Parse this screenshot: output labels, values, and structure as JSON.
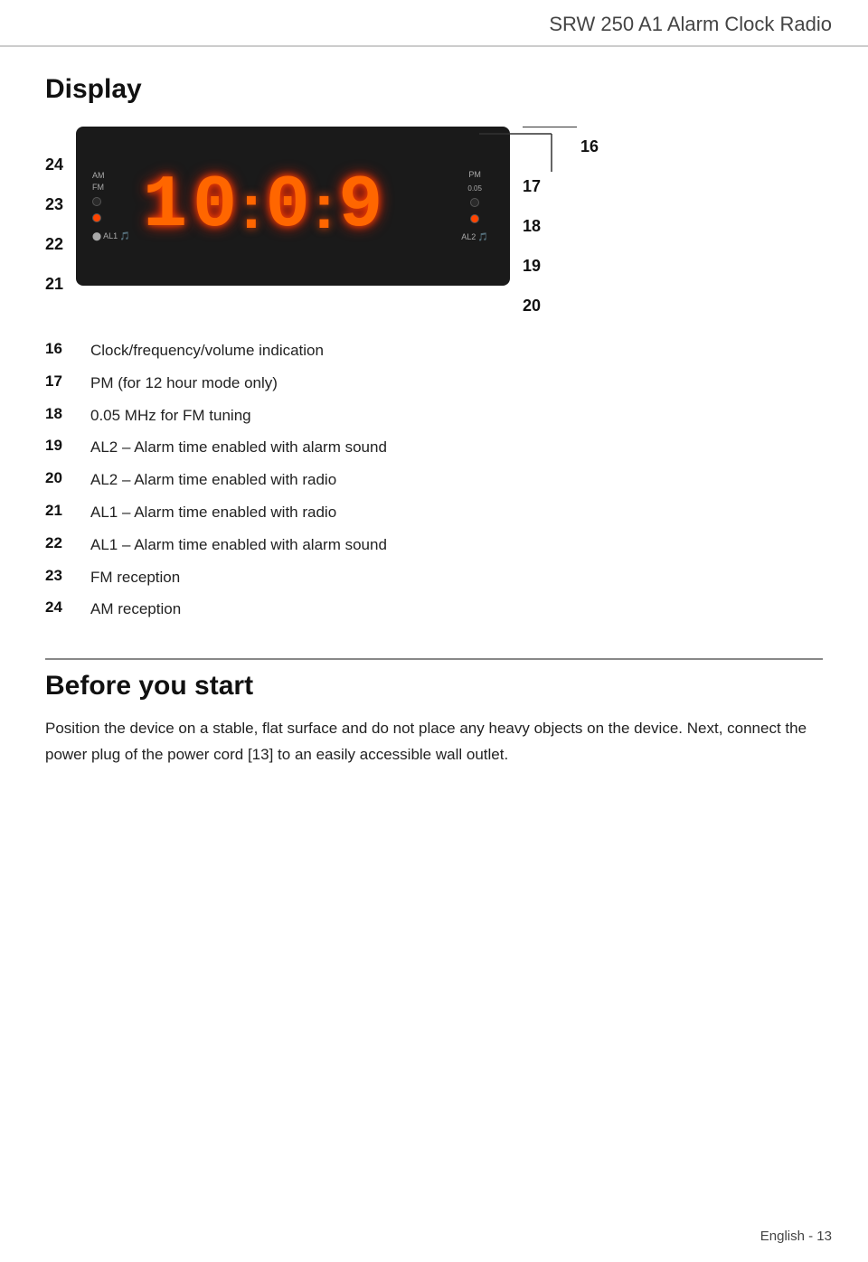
{
  "header": {
    "title": "SRW 250 A1 Alarm Clock Radio"
  },
  "display_section": {
    "title": "Display",
    "left_numbers": [
      "24",
      "23",
      "22",
      "21"
    ],
    "right_numbers": [
      "16",
      "17",
      "18",
      "19",
      "20"
    ],
    "clock_labels": {
      "am": "AM",
      "fm": "FM",
      "al1": "AL1",
      "pm": "PM",
      "freq": "0.05",
      "al2": "AL2"
    },
    "clock_digits": "10:09",
    "descriptions": [
      {
        "num": "16",
        "text": "Clock/frequency/volume indication"
      },
      {
        "num": "17",
        "text": "PM (for 12 hour mode only)"
      },
      {
        "num": "18",
        "text": "0.05 MHz for FM tuning"
      },
      {
        "num": "19",
        "text": "AL2 – Alarm time enabled with alarm sound"
      },
      {
        "num": "20",
        "text": "AL2 – Alarm time enabled with radio"
      },
      {
        "num": "21",
        "text": "AL1 – Alarm time enabled with radio"
      },
      {
        "num": "22",
        "text": "AL1 – Alarm time enabled with alarm sound"
      },
      {
        "num": "23",
        "text": "FM reception"
      },
      {
        "num": "24",
        "text": "AM reception"
      }
    ]
  },
  "before_section": {
    "title": "Before you start",
    "text": "Position the device on a stable, flat surface and do not place any heavy objects on the device. Next, connect the power plug of the power cord [13] to an easily accessible wall outlet."
  },
  "footer": {
    "text": "English - 13"
  }
}
